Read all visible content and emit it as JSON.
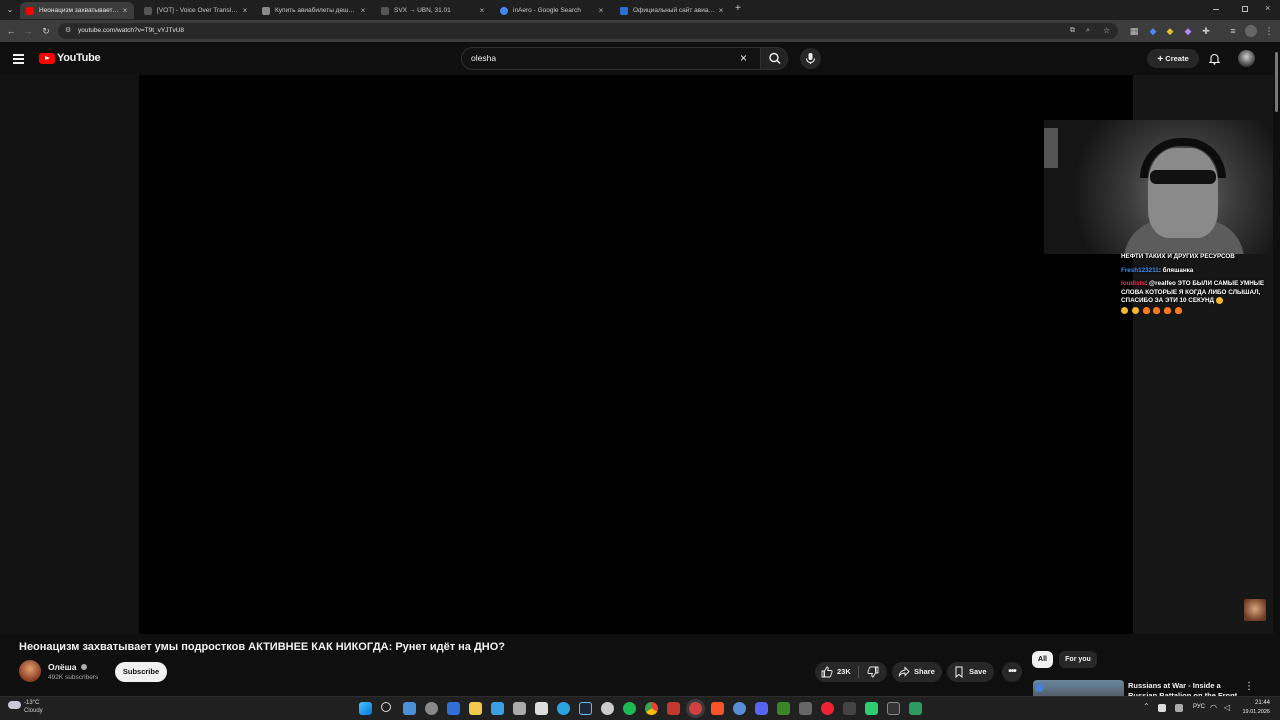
{
  "browser": {
    "tabs": [
      {
        "title": "Неонацизм захватывает умы подростков АКТИВНЕЕ КАК НИКОГДА: Рунет идёт на ДНО? - YouTube",
        "favicon_color": "#ff0000",
        "active": true
      },
      {
        "title": "[VOT] - Voice Over Translation",
        "favicon_color": "#555555",
        "active": false
      },
      {
        "title": "Купить авиабилеты дешево онлайн",
        "favicon_color": "#8a8a8a",
        "active": false
      },
      {
        "title": "SVX → UBN, 31.01",
        "favicon_color": "#555555",
        "active": false
      },
      {
        "title": "inAero - Google Search",
        "favicon_color": "#4285f4",
        "active": false
      },
      {
        "title": "Официальный сайт авиакомпании",
        "favicon_color": "#2a6fd6",
        "active": false
      }
    ],
    "new_tab_label": "+",
    "url": "youtube.com/watch?v=T9t_vYJTvU8"
  },
  "youtube": {
    "logo_text": "YouTube",
    "search_value": "olesha",
    "create_label": "Create"
  },
  "video": {
    "title": "Неонацизм захватывает умы подростков АКТИВНЕЕ КАК НИКОГДА: Рунет идёт на ДНО?",
    "channel": "Олёша",
    "subscribers": "492K subscribers",
    "subscribe_label": "Subscribe",
    "likes": "23K",
    "share_label": "Share",
    "save_label": "Save"
  },
  "chat": {
    "line1": "НЕФТИ ТАКИХ И ДРУГИХ РЕСУРСОВ",
    "line2_user": "Fresh123211",
    "line2_user_color": "#3a8fff",
    "line2_sep": ": ",
    "line2_text": "бляшанка",
    "line3_user": "loudists",
    "line3_user_color": "#ff2a4a",
    "line3_sep": ": ",
    "line3_text": "@realfeo ЭТО БЫЛИ САМЫЕ УМНЫЕ СЛОВА КОТОРЫЕ Я КОГДА ЛИБО СЛЫШАЛ, СПАСИБО ЗА ЭТИ 10 СЕКУНД"
  },
  "recommendations": {
    "chips": [
      "All",
      "For you"
    ],
    "first_title": "Russians at War - Inside a Russian Battalion on the Front"
  },
  "taskbar": {
    "weather_temp": "-13°C",
    "weather_desc": "Cloudy",
    "language": "РУС",
    "time": "21:44",
    "date": "19.01.2026"
  },
  "colors": {
    "youtube_red": "#ff0000",
    "background": "#0f0f0f"
  }
}
